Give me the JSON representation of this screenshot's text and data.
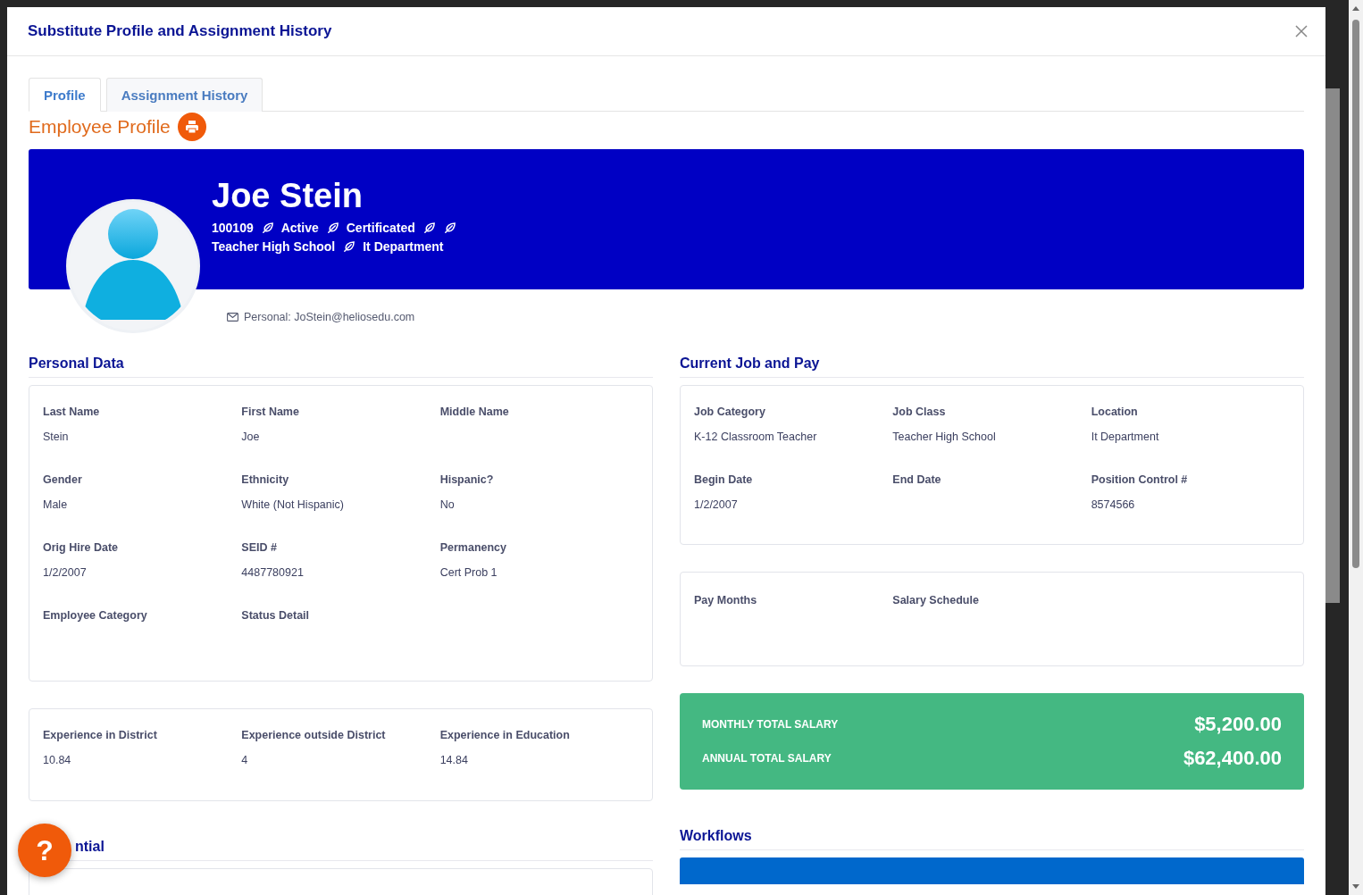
{
  "modal": {
    "title": "Substitute Profile and Assignment History"
  },
  "tabs": [
    {
      "label": "Profile",
      "selected": true
    },
    {
      "label": "Assignment History",
      "selected": false
    }
  ],
  "profile_heading": "Employee Profile",
  "banner": {
    "name": "Joe Stein",
    "lines": [
      [
        {
          "kind": "text",
          "text": "100109"
        },
        {
          "kind": "separator"
        },
        {
          "kind": "text",
          "text": "Active"
        },
        {
          "kind": "separator"
        },
        {
          "kind": "text",
          "text": "Certificated"
        },
        {
          "kind": "separator"
        },
        {
          "kind": "separator"
        }
      ],
      [
        {
          "kind": "text",
          "text": "Teacher High School"
        },
        {
          "kind": "separator"
        },
        {
          "kind": "text",
          "text": "It Department"
        }
      ]
    ]
  },
  "email": "Personal: JoStein@heliosedu.com",
  "personal_data": {
    "title": "Personal Data",
    "fields": [
      {
        "label": "Last Name",
        "value": "Stein"
      },
      {
        "label": "First Name",
        "value": "Joe"
      },
      {
        "label": "Middle Name"
      },
      {
        "label": "Gender",
        "value": "Male"
      },
      {
        "label": "Ethnicity",
        "value": "White (Not Hispanic)"
      },
      {
        "label": "Hispanic?",
        "value": "No"
      },
      {
        "label": "Orig Hire Date",
        "value": "1/2/2007"
      },
      {
        "label": "SEID #",
        "value": "4487780921"
      },
      {
        "label": "Permanency",
        "value": "Cert Prob 1"
      },
      {
        "label": "Employee Category"
      },
      {
        "label": "Status Detail"
      }
    ]
  },
  "experience": {
    "fields": [
      {
        "label": "Experience in District",
        "value": "10.84"
      },
      {
        "label": "Experience outside District",
        "value": "4"
      },
      {
        "label": "Experience in Education",
        "value": "14.84"
      }
    ]
  },
  "credential": {
    "title": "ntial"
  },
  "current_job": {
    "title": "Current Job and Pay",
    "fields": [
      {
        "label": "Job Category",
        "value": "K-12 Classroom Teacher"
      },
      {
        "label": "Job Class",
        "value": "Teacher High School"
      },
      {
        "label": "Location",
        "value": "It Department"
      },
      {
        "label": "Begin Date",
        "value": "1/2/2007"
      },
      {
        "label": "End Date"
      },
      {
        "label": "Position Control #",
        "value": "8574566"
      }
    ]
  },
  "pay": {
    "fields": [
      {
        "label": "Pay Months"
      },
      {
        "label": "Salary Schedule"
      }
    ]
  },
  "salary": [
    {
      "label": "MONTHLY TOTAL SALARY",
      "amount": "$5,200.00"
    },
    {
      "label": "ANNUAL TOTAL SALARY",
      "amount": "$62,400.00"
    }
  ],
  "workflows": {
    "title": "Workflows"
  },
  "help_button": {
    "label": "?"
  }
}
